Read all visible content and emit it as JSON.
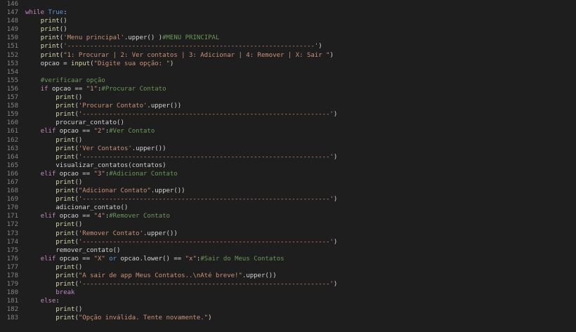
{
  "editor": {
    "lines": [
      {
        "n": "146",
        "tokens": []
      },
      {
        "n": "147",
        "tokens": [
          [
            "keyword",
            "while "
          ],
          [
            "const",
            "True"
          ],
          [
            "plain",
            ":"
          ]
        ]
      },
      {
        "n": "148",
        "tokens": [
          [
            "plain",
            "    "
          ],
          [
            "builtin",
            "print"
          ],
          [
            "plain",
            "()"
          ]
        ]
      },
      {
        "n": "149",
        "tokens": [
          [
            "plain",
            "    "
          ],
          [
            "builtin",
            "print"
          ],
          [
            "plain",
            "()"
          ]
        ]
      },
      {
        "n": "150",
        "tokens": [
          [
            "plain",
            "    "
          ],
          [
            "builtin",
            "print"
          ],
          [
            "plain",
            "("
          ],
          [
            "string",
            "'Menu principal'"
          ],
          [
            "plain",
            ".upper() )"
          ],
          [
            "comment",
            "#MENU PRINCIPAL"
          ]
        ]
      },
      {
        "n": "151",
        "tokens": [
          [
            "plain",
            "    "
          ],
          [
            "builtin",
            "print"
          ],
          [
            "plain",
            "("
          ],
          [
            "string",
            "'-----------------------------------------------------------------'"
          ],
          [
            "plain",
            ")"
          ]
        ]
      },
      {
        "n": "152",
        "tokens": [
          [
            "plain",
            "    "
          ],
          [
            "builtin",
            "print"
          ],
          [
            "plain",
            "("
          ],
          [
            "string",
            "\"1: Procurar | 2: Ver contatos | 3: Adicionar | 4: Remover | X: Sair \""
          ],
          [
            "plain",
            ")"
          ]
        ]
      },
      {
        "n": "153",
        "tokens": [
          [
            "plain",
            "    opcao = "
          ],
          [
            "builtin",
            "input"
          ],
          [
            "plain",
            "("
          ],
          [
            "string",
            "\"Digite sua opção: \""
          ],
          [
            "plain",
            ")"
          ]
        ]
      },
      {
        "n": "154",
        "tokens": []
      },
      {
        "n": "155",
        "tokens": [
          [
            "plain",
            "    "
          ],
          [
            "comment",
            "#verificaar opção"
          ]
        ]
      },
      {
        "n": "156",
        "tokens": [
          [
            "plain",
            "    "
          ],
          [
            "keyword",
            "if"
          ],
          [
            "plain",
            " opcao == "
          ],
          [
            "string",
            "\"1\""
          ],
          [
            "plain",
            ":"
          ],
          [
            "comment",
            "#Procurar Contato"
          ]
        ]
      },
      {
        "n": "157",
        "tokens": [
          [
            "plain",
            "        "
          ],
          [
            "builtin",
            "print"
          ],
          [
            "plain",
            "()"
          ]
        ]
      },
      {
        "n": "158",
        "tokens": [
          [
            "plain",
            "        "
          ],
          [
            "builtin",
            "print"
          ],
          [
            "plain",
            "("
          ],
          [
            "string",
            "'Procurar Contato'"
          ],
          [
            "plain",
            ".upper())"
          ]
        ]
      },
      {
        "n": "159",
        "tokens": [
          [
            "plain",
            "        "
          ],
          [
            "builtin",
            "print"
          ],
          [
            "plain",
            "("
          ],
          [
            "string",
            "'-----------------------------------------------------------------'"
          ],
          [
            "plain",
            ")"
          ]
        ]
      },
      {
        "n": "160",
        "tokens": [
          [
            "plain",
            "        procurar_contato()"
          ]
        ]
      },
      {
        "n": "161",
        "tokens": [
          [
            "plain",
            "    "
          ],
          [
            "keyword",
            "elif"
          ],
          [
            "plain",
            " opcao == "
          ],
          [
            "string",
            "\"2\""
          ],
          [
            "plain",
            ":"
          ],
          [
            "comment",
            "#Ver Contato"
          ]
        ]
      },
      {
        "n": "162",
        "tokens": [
          [
            "plain",
            "        "
          ],
          [
            "builtin",
            "print"
          ],
          [
            "plain",
            "()"
          ]
        ]
      },
      {
        "n": "163",
        "tokens": [
          [
            "plain",
            "        "
          ],
          [
            "builtin",
            "print"
          ],
          [
            "plain",
            "("
          ],
          [
            "string",
            "'Ver Contatos'"
          ],
          [
            "plain",
            ".upper())"
          ]
        ]
      },
      {
        "n": "164",
        "tokens": [
          [
            "plain",
            "        "
          ],
          [
            "builtin",
            "print"
          ],
          [
            "plain",
            "("
          ],
          [
            "string",
            "'-----------------------------------------------------------------'"
          ],
          [
            "plain",
            ")"
          ]
        ]
      },
      {
        "n": "165",
        "tokens": [
          [
            "plain",
            "        visualizar_contatos(contatos)"
          ]
        ]
      },
      {
        "n": "166",
        "tokens": [
          [
            "plain",
            "    "
          ],
          [
            "keyword",
            "elif"
          ],
          [
            "plain",
            " opcao == "
          ],
          [
            "string",
            "\"3\""
          ],
          [
            "plain",
            ":"
          ],
          [
            "comment",
            "#Adicionar Contato"
          ]
        ]
      },
      {
        "n": "167",
        "tokens": [
          [
            "plain",
            "        "
          ],
          [
            "builtin",
            "print"
          ],
          [
            "plain",
            "()"
          ]
        ]
      },
      {
        "n": "168",
        "tokens": [
          [
            "plain",
            "        "
          ],
          [
            "builtin",
            "print"
          ],
          [
            "plain",
            "("
          ],
          [
            "string",
            "\"Adicionar Contato\""
          ],
          [
            "plain",
            ".upper())"
          ]
        ]
      },
      {
        "n": "169",
        "tokens": [
          [
            "plain",
            "        "
          ],
          [
            "builtin",
            "print"
          ],
          [
            "plain",
            "("
          ],
          [
            "string",
            "'-----------------------------------------------------------------'"
          ],
          [
            "plain",
            ")"
          ]
        ]
      },
      {
        "n": "170",
        "tokens": [
          [
            "plain",
            "        adicionar_contato()"
          ]
        ]
      },
      {
        "n": "171",
        "tokens": [
          [
            "plain",
            "    "
          ],
          [
            "keyword",
            "elif"
          ],
          [
            "plain",
            " opcao == "
          ],
          [
            "string",
            "\"4\""
          ],
          [
            "plain",
            ":"
          ],
          [
            "comment",
            "#Remover Contato"
          ]
        ]
      },
      {
        "n": "172",
        "tokens": [
          [
            "plain",
            "        "
          ],
          [
            "builtin",
            "print"
          ],
          [
            "plain",
            "()"
          ]
        ]
      },
      {
        "n": "173",
        "tokens": [
          [
            "plain",
            "        "
          ],
          [
            "builtin",
            "print"
          ],
          [
            "plain",
            "("
          ],
          [
            "string",
            "'Remover Contato'"
          ],
          [
            "plain",
            ".upper())"
          ]
        ]
      },
      {
        "n": "174",
        "tokens": [
          [
            "plain",
            "        "
          ],
          [
            "builtin",
            "print"
          ],
          [
            "plain",
            "("
          ],
          [
            "string",
            "'-----------------------------------------------------------------'"
          ],
          [
            "plain",
            ")"
          ]
        ]
      },
      {
        "n": "175",
        "tokens": [
          [
            "plain",
            "        remover_contato()"
          ]
        ]
      },
      {
        "n": "176",
        "tokens": [
          [
            "plain",
            "    "
          ],
          [
            "keyword",
            "elif"
          ],
          [
            "plain",
            " opcao == "
          ],
          [
            "string",
            "\"X\""
          ],
          [
            "plain",
            " "
          ],
          [
            "const",
            "or"
          ],
          [
            "plain",
            " opcao.lower() == "
          ],
          [
            "string",
            "\"x\""
          ],
          [
            "plain",
            ":"
          ],
          [
            "comment",
            "#Sair do Meus Contatos"
          ]
        ]
      },
      {
        "n": "177",
        "tokens": [
          [
            "plain",
            "        "
          ],
          [
            "builtin",
            "print"
          ],
          [
            "plain",
            "()"
          ]
        ]
      },
      {
        "n": "178",
        "tokens": [
          [
            "plain",
            "        "
          ],
          [
            "builtin",
            "print"
          ],
          [
            "plain",
            "("
          ],
          [
            "string",
            "\"A sair de app Meus Contatos..\\nAté breve!\""
          ],
          [
            "plain",
            ".upper())"
          ]
        ]
      },
      {
        "n": "179",
        "tokens": [
          [
            "plain",
            "        "
          ],
          [
            "builtin",
            "print"
          ],
          [
            "plain",
            "("
          ],
          [
            "string",
            "'-----------------------------------------------------------------'"
          ],
          [
            "plain",
            ")"
          ]
        ]
      },
      {
        "n": "180",
        "tokens": [
          [
            "plain",
            "        "
          ],
          [
            "keyword",
            "break"
          ]
        ]
      },
      {
        "n": "181",
        "tokens": [
          [
            "plain",
            "    "
          ],
          [
            "keyword",
            "else"
          ],
          [
            "plain",
            ":"
          ]
        ]
      },
      {
        "n": "182",
        "tokens": [
          [
            "plain",
            "        "
          ],
          [
            "builtin",
            "print"
          ],
          [
            "plain",
            "()"
          ]
        ]
      },
      {
        "n": "183",
        "tokens": [
          [
            "plain",
            "        "
          ],
          [
            "builtin",
            "print"
          ],
          [
            "plain",
            "("
          ],
          [
            "string",
            "\"Opção inválida. Tente novamente.\""
          ],
          [
            "plain",
            ")"
          ]
        ]
      }
    ]
  },
  "colors": {
    "background": "#1e1e1e",
    "line_number": "#858585",
    "keyword": "#c586c0",
    "builtin": "#dcdcaa",
    "constant": "#569cd6",
    "string": "#ce9178",
    "comment": "#6a9955",
    "plain": "#d4d4d4"
  }
}
